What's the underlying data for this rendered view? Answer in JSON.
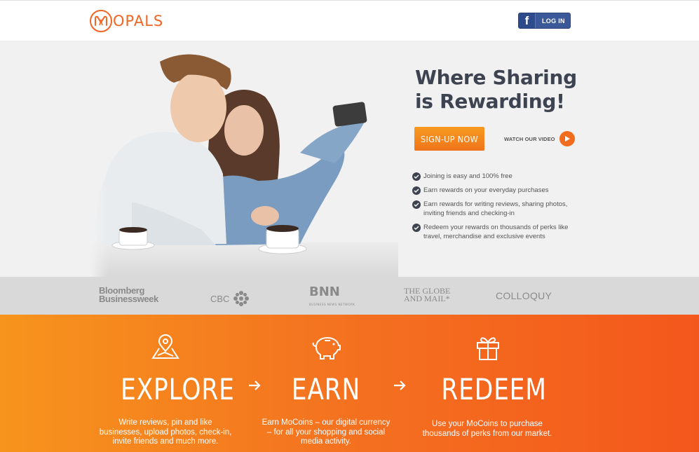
{
  "header": {
    "logo_text": "OPALS",
    "login_label": "LOG IN",
    "facebook_letter": "f"
  },
  "hero": {
    "title": "Where Sharing is Rewarding!",
    "signup_label": "SIGN-UP NOW",
    "video_label": "WATCH OUR VIDEO",
    "benefits": [
      "Joining is easy and 100% free",
      "Earn rewards on your everyday purchases",
      "Earn rewards for writing reviews, sharing photos, inviting friends and checking-in",
      "Redeem your rewards on thousands of perks like travel, merchandise and exclusive events"
    ]
  },
  "press": {
    "bloomberg_line1": "Bloomberg",
    "bloomberg_line2": "Businessweek",
    "cbc": "CBC",
    "bnn": "BNN",
    "bnn_sub": "BUSINESS NEWS NETWORK",
    "globe_line1": "THE GLOBE",
    "globe_line2": "AND MAIL*",
    "colloquy": "COLLOQUY"
  },
  "steps": [
    {
      "title": "EXPLORE",
      "icon": "map-pin-icon",
      "text": "Write reviews, pin and like businesses, upload photos, check-in, invite friends and much more."
    },
    {
      "title": "EARN",
      "icon": "piggy-bank-icon",
      "text": "Earn MoCoins – our digital currency – for all your shopping and social media activity."
    },
    {
      "title": "REDEEM",
      "icon": "gift-icon",
      "text": "Use your MoCoins to purchase thousands of perks from our market."
    }
  ],
  "colors": {
    "brand_orange": "#f26522",
    "facebook_blue": "#3b5998",
    "title_dark": "#3d4350",
    "press_bar": "#d9d9d9"
  }
}
